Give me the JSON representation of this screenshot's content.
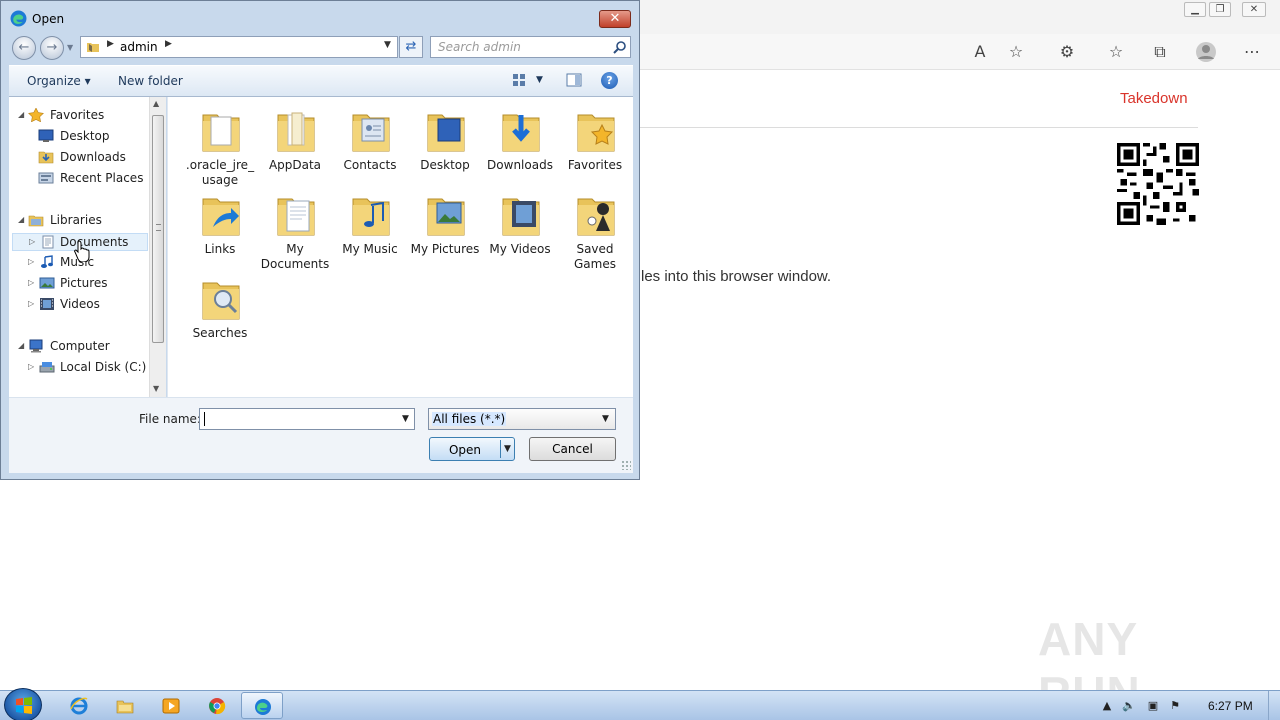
{
  "browser": {
    "takedown_link": "Takedown",
    "drop_text": "les into this browser window.",
    "watermark": "ANY RUN"
  },
  "dialog": {
    "title": "Open",
    "address": {
      "path": "admin"
    },
    "search": {
      "placeholder": "Search admin"
    },
    "command_bar": {
      "organize": "Organize ▾",
      "new_folder": "New folder"
    },
    "nav_tree": {
      "favorites": "Favorites",
      "desktop": "Desktop",
      "downloads": "Downloads",
      "recent_places": "Recent Places",
      "libraries": "Libraries",
      "documents": "Documents",
      "music": "Music",
      "pictures": "Pictures",
      "videos": "Videos",
      "computer": "Computer",
      "local_disk": "Local Disk (C:)"
    },
    "files": [
      {
        "label": ".oracle_jre_ usage",
        "icon": "folder-document-icon"
      },
      {
        "label": "AppData",
        "icon": "folder-icon"
      },
      {
        "label": "Contacts",
        "icon": "contacts-folder-icon"
      },
      {
        "label": "Desktop",
        "icon": "desktop-folder-icon"
      },
      {
        "label": "Downloads",
        "icon": "downloads-folder-icon"
      },
      {
        "label": "Favorites",
        "icon": "favorites-folder-icon"
      },
      {
        "label": "Links",
        "icon": "links-folder-icon"
      },
      {
        "label": "My Documents",
        "icon": "documents-folder-icon"
      },
      {
        "label": "My Music",
        "icon": "music-folder-icon"
      },
      {
        "label": "My Pictures",
        "icon": "pictures-folder-icon"
      },
      {
        "label": "My Videos",
        "icon": "videos-folder-icon"
      },
      {
        "label": "Saved Games",
        "icon": "games-folder-icon"
      },
      {
        "label": "Searches",
        "icon": "searches-folder-icon"
      }
    ],
    "file_name_label": "File name:",
    "file_name_value": "",
    "file_type_value": "All files (*.*)",
    "open_button": "Open",
    "cancel_button": "Cancel"
  },
  "taskbar": {
    "clock": "6:27 PM"
  },
  "colors": {
    "takedown": "#d9342b",
    "dialog_frame": "#c8d9ec",
    "taskbar": "#bcd3ee"
  }
}
